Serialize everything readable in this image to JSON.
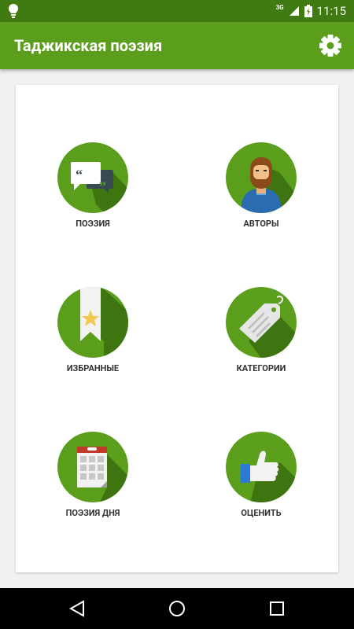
{
  "status_bar": {
    "network": "3G",
    "time": "11:15"
  },
  "app_bar": {
    "title": "Таджикская поэзия",
    "settings_icon": "gear-icon"
  },
  "tiles": [
    {
      "label": "ПОЭЗИЯ",
      "icon": "quote-bubbles-icon"
    },
    {
      "label": "АВТОРЫ",
      "icon": "author-icon"
    },
    {
      "label": "ИЗБРАННЫЕ",
      "icon": "bookmark-star-icon"
    },
    {
      "label": "КАТЕГОРИИ",
      "icon": "tag-icon"
    },
    {
      "label": "ПОЭЗИЯ ДНЯ",
      "icon": "calendar-icon"
    },
    {
      "label": "ОЦЕНИТЬ",
      "icon": "thumbs-up-icon"
    }
  ],
  "colors": {
    "status_bar": "#3f7a13",
    "app_bar": "#5a9e1c",
    "tile_circle": "#5a9e1c",
    "tile_shadow": "#3e7510"
  },
  "nav_bar": {
    "back_icon": "back-triangle-icon",
    "home_icon": "home-circle-icon",
    "recents_icon": "recents-square-icon"
  }
}
